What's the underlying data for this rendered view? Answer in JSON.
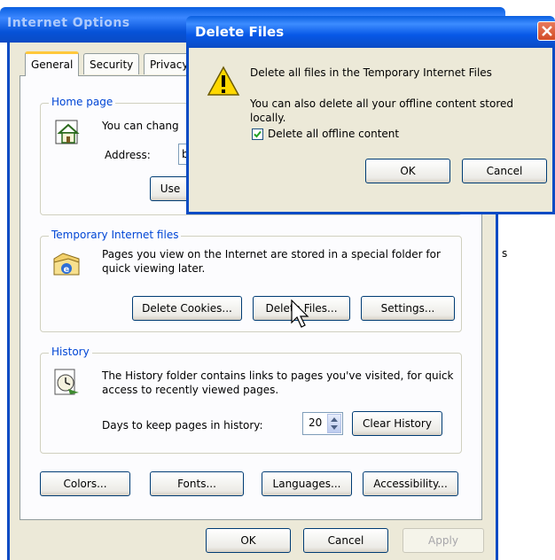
{
  "io": {
    "title": "Internet Options",
    "tabs": [
      "General",
      "Security",
      "Privacy"
    ],
    "homepage": {
      "label": "Home page",
      "text": "You can chang",
      "address_label": "Address:",
      "address_value": "b",
      "use_button": "Use"
    },
    "temp_files": {
      "label": "Temporary Internet files",
      "text": "Pages you view on the Internet are stored in a special folder for quick viewing later.",
      "delete_cookies": "Delete Cookies...",
      "delete_files": "Delete Files...",
      "settings": "Settings..."
    },
    "history": {
      "label": "History",
      "text": "The History folder contains links to pages you've visited, for quick access to recently viewed pages.",
      "days_label": "Days to keep pages in history:",
      "days_value": "20",
      "clear": "Clear History"
    },
    "bottom_buttons": [
      "Colors...",
      "Fonts...",
      "Languages...",
      "Accessibility..."
    ],
    "footer": {
      "ok": "OK",
      "cancel": "Cancel",
      "apply": "Apply"
    },
    "side_fragment": "s"
  },
  "dialog": {
    "title": "Delete Files",
    "message1": "Delete all files in the Temporary Internet Files",
    "message2": "You can also delete all your offline content stored locally.",
    "checkbox_label": "Delete all offline content",
    "checkbox_checked": true,
    "ok": "OK",
    "cancel": "Cancel"
  },
  "colors": {
    "xp_blue": "#0a4bc4",
    "group_label": "#0046d5",
    "dialog_face": "#ece9d8"
  }
}
